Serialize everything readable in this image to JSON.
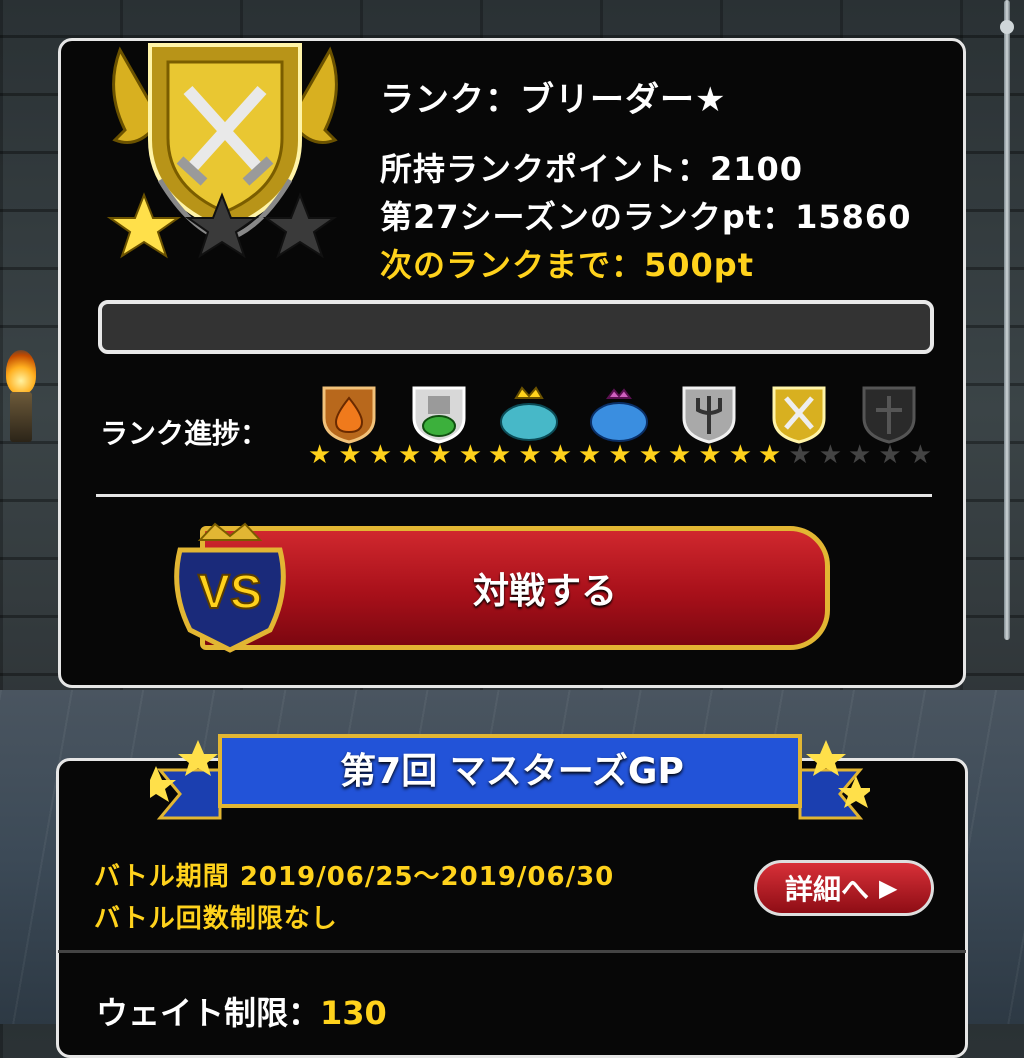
{
  "rank": {
    "title": "ランク：ブリーダー★",
    "points_label": "所持ランクポイント：2100",
    "season_label": "第27シーズンのランクpt：15860",
    "next_label": "次のランクまで：500pt",
    "stars_earned": 1,
    "stars_total": 3,
    "progress": 0.0
  },
  "progress_section": {
    "label": "ランク進捗：",
    "icons": [
      {
        "name": "she-slime-crest-icon",
        "stars_on": 3
      },
      {
        "name": "slime-knight-crest-icon",
        "stars_on": 3
      },
      {
        "name": "king-slime-crest-icon",
        "stars_on": 3
      },
      {
        "name": "queen-slime-crest-icon",
        "stars_on": 3
      },
      {
        "name": "silver-trident-crest-icon",
        "stars_on": 3
      },
      {
        "name": "gold-swords-crest-icon",
        "stars_on": 1
      },
      {
        "name": "black-crest-icon",
        "stars_on": 0
      }
    ]
  },
  "battle_button": {
    "label": "対戦する",
    "badge": "VS"
  },
  "grand_prix": {
    "title": "第7回 マスターズGP",
    "period": "バトル期間 2019/06/25〜2019/06/30",
    "limit": "バトル回数制限なし",
    "detail_label": "詳細へ",
    "weight_label": "ウェイト制限：",
    "weight_value": "130"
  },
  "colors": {
    "accent_gold": "#ffd21c",
    "button_red": "#a8101a"
  }
}
